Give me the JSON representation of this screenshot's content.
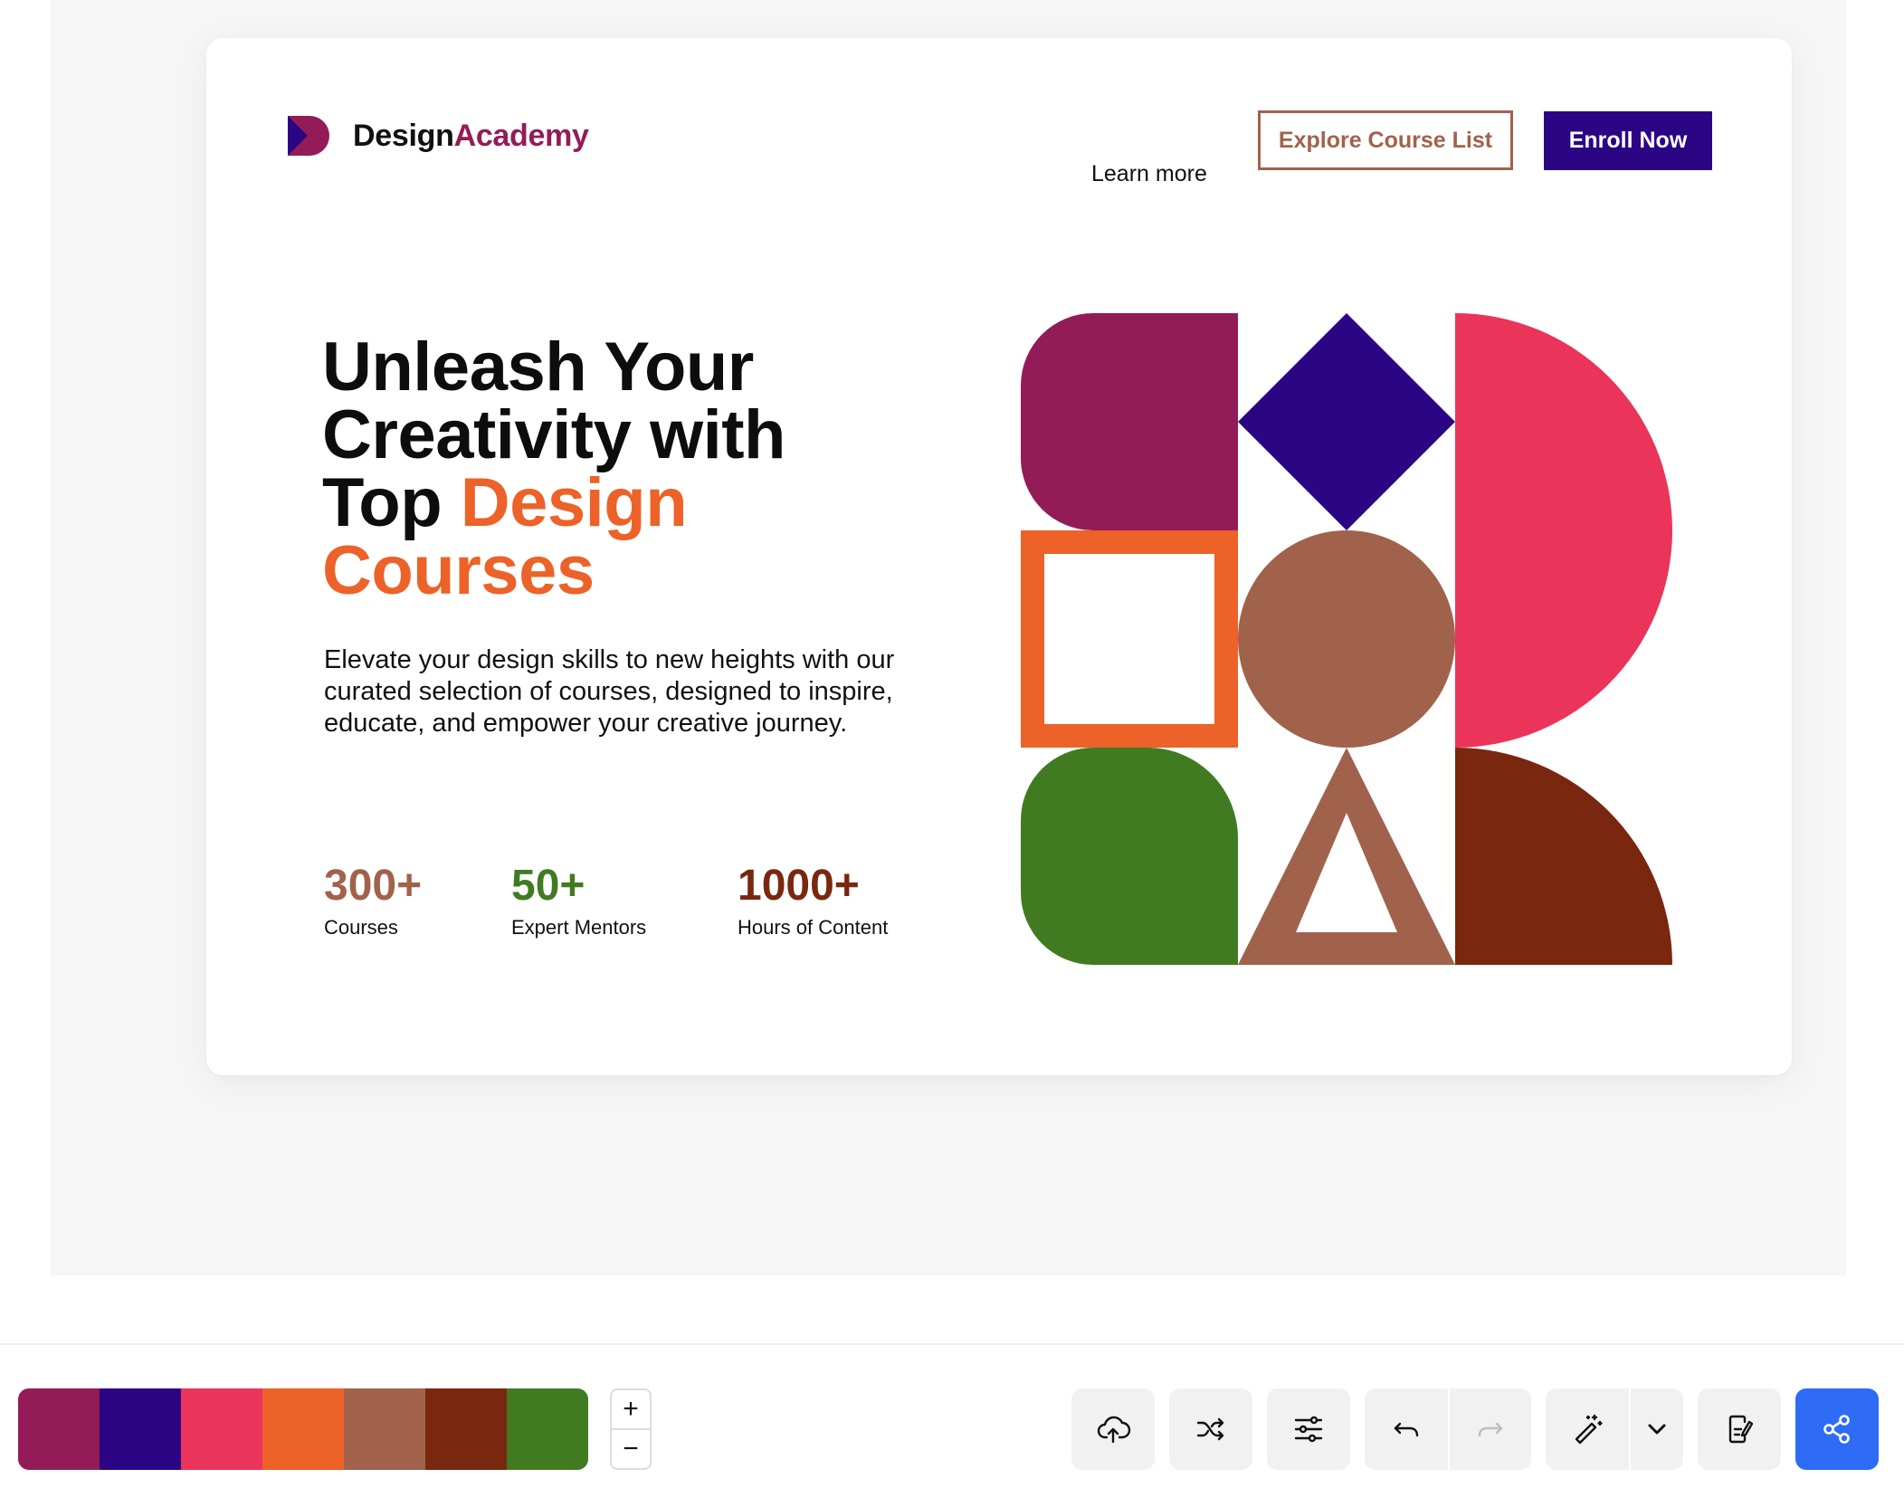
{
  "header": {
    "brand_part1": "Design",
    "brand_part2": "Academy",
    "nav_learn": "Learn more",
    "explore_label": "Explore Course List",
    "enroll_label": "Enroll Now",
    "logo_icon": "design-academy-logo-icon"
  },
  "hero": {
    "title_line1": "Unleash Your",
    "title_line2": "Creativity with",
    "title_line3_plain": "Top ",
    "title_line3_highlight": "Design",
    "title_line4": "Courses",
    "description": "Elevate your design skills to new heights with our curated selection of courses, designed to inspire, educate, and empower your creative journey."
  },
  "stats": [
    {
      "value": "300+",
      "label": "Courses"
    },
    {
      "value": "50+",
      "label": "Expert Mentors"
    },
    {
      "value": "1000+",
      "label": "Hours of Content"
    }
  ],
  "colors": {
    "plum": "#931c58",
    "indigo": "#2c0585",
    "raspberry": "#ea345a",
    "orange": "#ec6229",
    "terracotta": "#a1624c",
    "rust": "#7a2710",
    "green": "#407b21",
    "share_blue": "#2e6cf6"
  },
  "palette": [
    "#931c58",
    "#2c0585",
    "#ea345a",
    "#ec6229",
    "#a1624c",
    "#7a2710",
    "#407b21"
  ],
  "zoom": {
    "in_symbol": "+",
    "out_symbol": "−"
  },
  "toolbar": {
    "icons": [
      "upload-cloud-icon",
      "shuffle-icon",
      "sliders-icon",
      "undo-icon",
      "redo-icon",
      "magic-wand-icon",
      "chevron-down-icon",
      "export-icon",
      "share-icon"
    ]
  }
}
